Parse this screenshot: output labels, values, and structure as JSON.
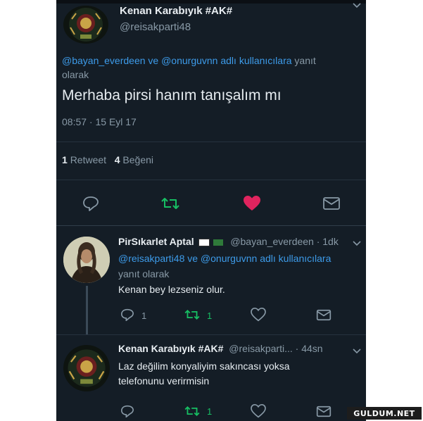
{
  "main_tweet": {
    "author_name": "Kenan Karabıyık #AK#",
    "author_handle": "@reisakparti48",
    "reply_mentions": "@bayan_everdeen ve @onurguvnn adlı kullanıcılara",
    "reply_suffix_line1": "yanıt",
    "reply_suffix_line2": "olarak",
    "text": "Merhaba pirsi hanım tanışalım mı",
    "timestamp": "08:57 · 15 Eyl 17",
    "retweet_count": "1",
    "retweet_label": "Retweet",
    "like_count": "4",
    "like_label": "Beğeni"
  },
  "reply_1": {
    "author_name": "PirSıkarlet Aptal",
    "author_meta": "@bayan_everdeen · 1dk",
    "reply_mentions": "@reisakparti48 ve @onurguvnn adlı kullanıcılara",
    "reply_suffix": "yanıt olarak",
    "text": "Kenan bey lezseniz olur.",
    "reply_count": "1",
    "retweet_count": "1"
  },
  "reply_2": {
    "author_name": "Kenan Karabıyık #AK#",
    "author_meta": "@reisakparti... · 44sn",
    "text_line1": "Laz değilim konyaliyim sakıncası yoksa",
    "text_line2": "telefonunu verirmisin",
    "retweet_count": "1"
  },
  "watermark": "GULDUM.NET",
  "icons": [
    "reply-icon",
    "retweet-icon",
    "like-icon",
    "message-icon",
    "chevron-down-icon"
  ],
  "colors": {
    "background": "#141d26",
    "mention": "#3d9be9",
    "retweet": "#17bf63",
    "like": "#e0245e",
    "muted": "#8899a6"
  }
}
